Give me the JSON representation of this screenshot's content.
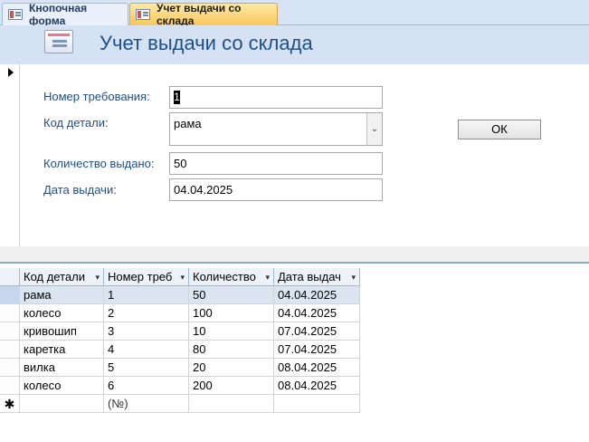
{
  "tabs": [
    {
      "label": "Кнопочная форма",
      "active": false
    },
    {
      "label": "Учет выдачи со склада",
      "active": true
    }
  ],
  "form": {
    "title": "Учет выдачи со склада",
    "fields": {
      "req_label": "Номер требования:",
      "req_value": "1",
      "part_label": "Код детали:",
      "part_value": "рама",
      "qty_label": "Количество выдано:",
      "qty_value": "50",
      "date_label": "Дата выдачи:",
      "date_value": "04.04.2025"
    },
    "ok_label": "ОК"
  },
  "datasheet": {
    "columns": [
      "Код детали",
      "Номер треб",
      "Количество",
      "Дата выдач"
    ],
    "rows": [
      {
        "part": "рама",
        "num": "1",
        "qty": "50",
        "date": "04.04.2025"
      },
      {
        "part": "колесо",
        "num": "2",
        "qty": "100",
        "date": "04.04.2025"
      },
      {
        "part": "кривошип",
        "num": "3",
        "qty": "10",
        "date": "07.04.2025"
      },
      {
        "part": "каретка",
        "num": "4",
        "qty": "80",
        "date": "07.04.2025"
      },
      {
        "part": "вилка",
        "num": "5",
        "qty": "20",
        "date": "08.04.2025"
      },
      {
        "part": "колесо",
        "num": "6",
        "qty": "200",
        "date": "08.04.2025"
      }
    ],
    "new_row_placeholder": "(№)"
  },
  "colors": {
    "accent_blue": "#1f4e8c",
    "active_tab": "#f7c75a",
    "header_bg": "#d4e2f4"
  }
}
